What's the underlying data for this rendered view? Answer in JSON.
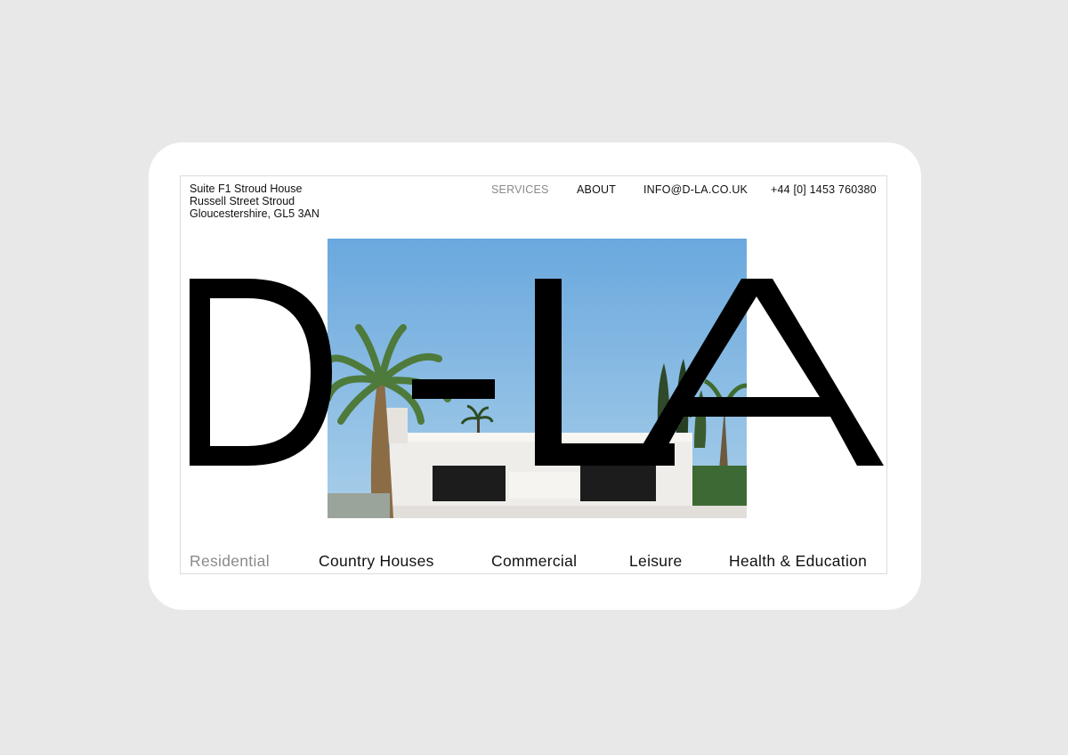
{
  "address": {
    "line1": "Suite F1 Stroud House",
    "line2": "Russell Street Stroud",
    "line3": "Gloucestershire, GL5 3AN"
  },
  "nav": {
    "services": "SERVICES",
    "about": "ABOUT",
    "email": "INFO@D-LA.CO.UK",
    "phone": "+44 [0] 1453 760380"
  },
  "logo": {
    "text": "D-LA"
  },
  "hero": {
    "image": "modern-white-house-with-palm-trees"
  },
  "categories": {
    "residential": "Residential",
    "country_houses": "Country Houses",
    "commercial": "Commercial",
    "leisure": "Leisure",
    "health_education": "Health & Education"
  },
  "colors": {
    "background": "#e8e8e8",
    "text": "#111111",
    "muted": "#8a8a8a",
    "sky": "#7fb6e0"
  }
}
